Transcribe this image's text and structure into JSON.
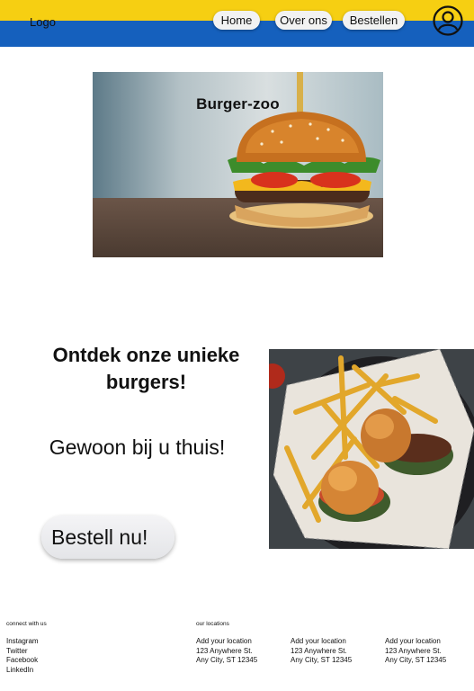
{
  "header": {
    "logo": "Logo",
    "nav": [
      "Home",
      "Over ons",
      "Bestellen"
    ],
    "colors": {
      "top_bar": "#f6cf12",
      "bottom_bar": "#1560bd"
    },
    "user_icon": "user-account-icon"
  },
  "hero": {
    "title": "Burger-zoo"
  },
  "promo": {
    "heading": "Ontdek onze unieke burgers!",
    "subheading": "Gewoon bij u thuis!",
    "cta": "Bestell nu!"
  },
  "footer": {
    "social_heading": "connect with us",
    "social_links": [
      "Instagram",
      "Twitter",
      "Facebook",
      "LinkedIn"
    ],
    "locations_heading": "our locations",
    "locations": [
      {
        "name": "Add your location",
        "street": "123 Anywhere St.",
        "city": "Any City, ST 12345"
      },
      {
        "name": "Add your location",
        "street": "123 Anywhere St.",
        "city": "Any City, ST 12345"
      },
      {
        "name": "Add your location",
        "street": "123 Anywhere St.",
        "city": "Any City, ST 12345"
      }
    ]
  }
}
